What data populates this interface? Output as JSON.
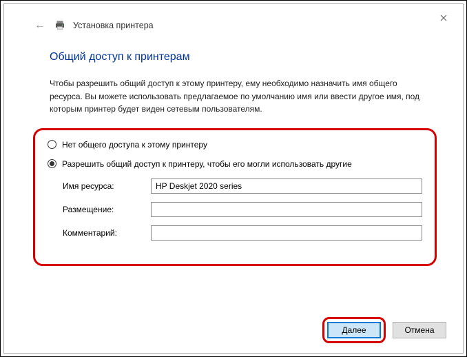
{
  "window": {
    "title": "Установка принтера"
  },
  "page": {
    "heading": "Общий доступ к принтерам",
    "intro": "Чтобы разрешить общий доступ к этому принтеру, ему необходимо назначить имя общего ресурса. Вы можете использовать предлагаемое по умолчанию имя или ввести другое имя, под которым принтер будет виден сетевым пользователям."
  },
  "options": {
    "no_share": "Нет общего доступа к этому принтеру",
    "share": "Разрешить общий доступ к принтеру, чтобы его могли использовать другие",
    "selected": "share"
  },
  "fields": {
    "share_name_label": "Имя ресурса:",
    "share_name_value": "HP Deskjet 2020 series",
    "location_label": "Размещение:",
    "location_value": "",
    "comment_label": "Комментарий:",
    "comment_value": ""
  },
  "buttons": {
    "next": "Далее",
    "cancel": "Отмена"
  }
}
